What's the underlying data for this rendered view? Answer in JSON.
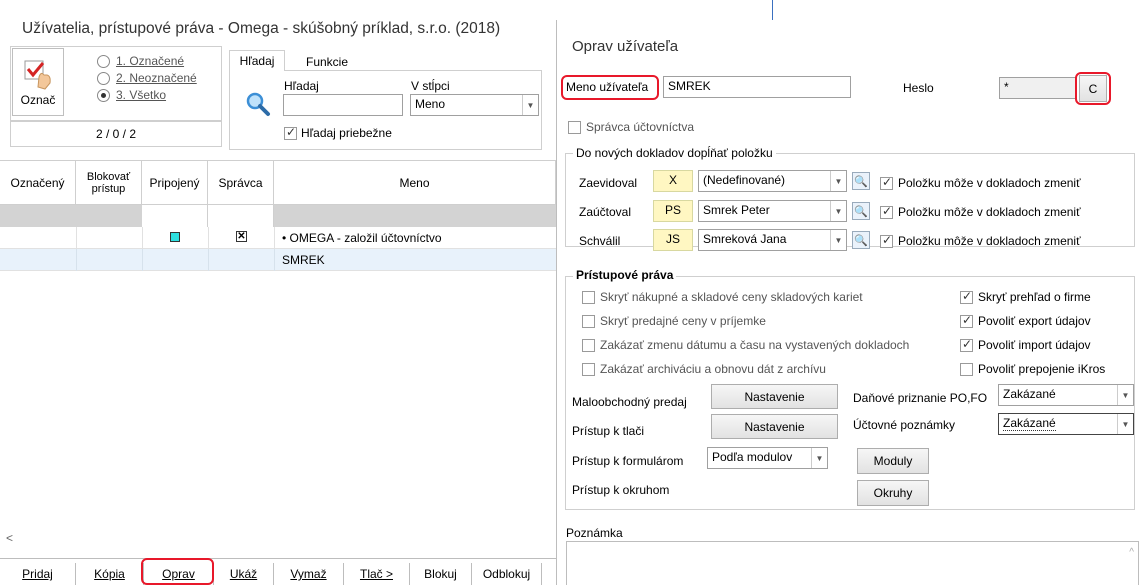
{
  "window_title": "Užívatelia, prístupové práva - Omega - skúšobný príklad, s.r.o. (2018)",
  "mark_panel": {
    "mark_button_label": "Označ",
    "filter_options": [
      {
        "label": "1. Označené",
        "selected": false
      },
      {
        "label": "2. Neoznačené",
        "selected": false
      },
      {
        "label": "3. Všetko",
        "selected": true
      }
    ],
    "counter": "2 / 0 / 2"
  },
  "search_panel": {
    "tabs": [
      "Hľadaj",
      "Funkcie"
    ],
    "search_label": "Hľadaj",
    "search_value": "",
    "column_label": "V stĺpci",
    "column_value": "Meno",
    "live_search_label": "Hľadaj priebežne",
    "live_search_checked": true
  },
  "table": {
    "columns": [
      "Označený",
      "Blokovať prístup",
      "Pripojený",
      "Správca",
      "Meno"
    ],
    "rows": [
      {
        "connected": true,
        "admin": true,
        "name": "• OMEGA - založil účtovníctvo"
      },
      {
        "connected": false,
        "admin": false,
        "name": "SMREK"
      }
    ]
  },
  "bottom_tabs": [
    "Pridaj",
    "Kópia",
    "Oprav",
    "Ukáž",
    "Vymaž",
    "Tlač >",
    "Blokuj",
    "Odblokuj"
  ],
  "dialog": {
    "title": "Oprav užívateľa",
    "username_label": "Meno užívateľa",
    "username_value": "SMREK",
    "password_label": "Heslo",
    "password_value": "*",
    "password_button": "C",
    "accountant_admin_label": "Správca účtovníctva",
    "accountant_admin_checked": false,
    "new_docs_group_title": "Do nových dokladov dopĺňať položku",
    "doc_rows": [
      {
        "label": "Zaevidoval",
        "code": "X",
        "name": "(Nedefinované)",
        "can_change_label": "Položku môže v dokladoch zmeniť",
        "checked": true
      },
      {
        "label": "Zaúčtoval",
        "code": "PS",
        "name": "Smrek Peter",
        "can_change_label": "Položku môže v dokladoch zmeniť",
        "checked": true
      },
      {
        "label": "Schválil",
        "code": "JS",
        "name": "Smreková Jana",
        "can_change_label": "Položku môže v dokladoch zmeniť",
        "checked": true
      }
    ],
    "access_group_title": "Prístupové práva",
    "access_left": [
      {
        "label": "Skryť nákupné a skladové ceny skladových kariet",
        "checked": false
      },
      {
        "label": "Skryť predajné ceny v príjemke",
        "checked": false
      },
      {
        "label": "Zakázať zmenu dátumu a času na vystavených dokladoch",
        "checked": false
      },
      {
        "label": "Zakázať archiváciu a obnovu dát z archívu",
        "checked": false
      }
    ],
    "access_right": [
      {
        "label": "Skryť prehľad o firme",
        "checked": true
      },
      {
        "label": "Povoliť export údajov",
        "checked": true
      },
      {
        "label": "Povoliť import údajov",
        "checked": true
      },
      {
        "label": "Povoliť prepojenie iKros",
        "checked": false
      }
    ],
    "retail_label": "Maloobchodný predaj",
    "retail_button": "Nastavenie",
    "print_label": "Prístup k tlači",
    "print_button": "Nastavenie",
    "forms_label": "Prístup k formulárom",
    "forms_value": "Podľa modulov",
    "modules_button": "Moduly",
    "areas_label": "Prístup k okruhom",
    "areas_button": "Okruhy",
    "tax_label": "Daňové priznanie PO,FO",
    "tax_value": "Zakázané",
    "notes_label": "Účtovné poznámky",
    "notes_value": "Zakázané",
    "remark_label": "Poznámka"
  }
}
